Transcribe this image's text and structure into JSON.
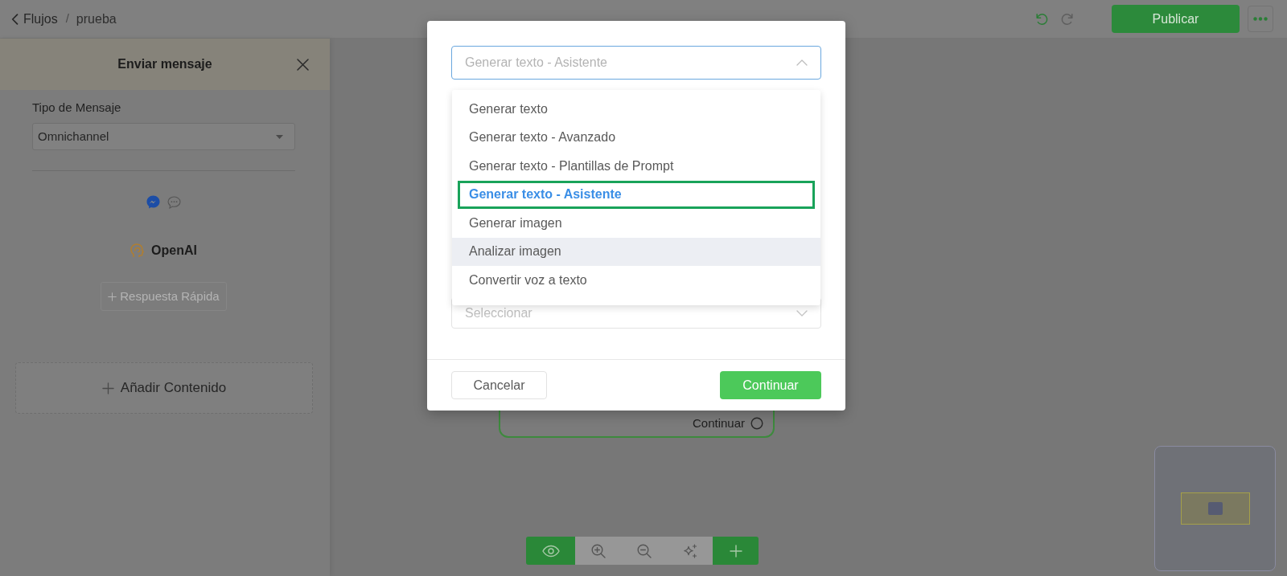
{
  "top_bar": {
    "back_label": "Flujos",
    "separator": "/",
    "current": "prueba",
    "undo": {
      "disabled": false
    },
    "redo": {
      "disabled": true
    },
    "publish_button": "Publicar"
  },
  "side_panel": {
    "title": "Enviar mensaje",
    "message_type": {
      "label": "Tipo de Mensaje",
      "value": "Omnichannel"
    },
    "integration": "OpenAI",
    "quick_reply_button": {
      "label": "Respuesta Rápida",
      "disabled": true
    },
    "add_content_button": "Añadir Contenido"
  },
  "canvas": {
    "node": {
      "output_label": "Continuar"
    },
    "toolbar": {
      "preview": {
        "on": true
      }
    }
  },
  "dialog": {
    "model_select": {
      "value": "Generar texto - Asistente",
      "expanded": true
    },
    "options": [
      {
        "label": "Generar texto",
        "selected": false,
        "hovered": false
      },
      {
        "label": "Generar texto - Avanzado",
        "selected": false,
        "hovered": false
      },
      {
        "label": "Generar texto - Plantillas de Prompt",
        "selected": false,
        "hovered": false
      },
      {
        "label": "Generar texto - Asistente",
        "selected": true,
        "hovered": false
      },
      {
        "label": "Generar imagen",
        "selected": false,
        "hovered": false
      },
      {
        "label": "Analizar imagen",
        "selected": false,
        "hovered": true
      },
      {
        "label": "Convertir voz a texto",
        "selected": false,
        "hovered": false
      }
    ],
    "second_select": {
      "placeholder": "Seleccionar"
    },
    "cancel_button": "Cancelar",
    "continue_button": "Continuar"
  }
}
